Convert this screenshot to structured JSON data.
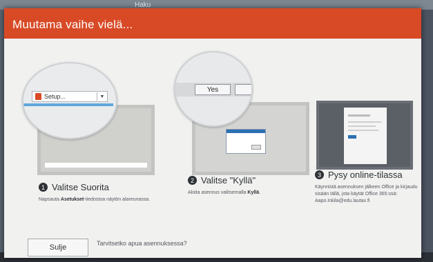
{
  "background": {
    "search_text": "Haku"
  },
  "dialog": {
    "title": "Muutama vaihe vielä...",
    "accent_color": "#d84a26",
    "steps": [
      {
        "number": "1",
        "title": "Valitse Suorita",
        "desc_prefix": "Napsauta ",
        "desc_bold": "Asetukset",
        "desc_suffix": "-tiedostoa näytön alareunassa.",
        "illustration_button": "Setup..."
      },
      {
        "number": "2",
        "title": "Valitse \"Kyllä\"",
        "desc_prefix": "Aloita asennus valitsemalla ",
        "desc_bold": "Kyllä",
        "desc_suffix": ".",
        "illustration_button": "Yes"
      },
      {
        "number": "3",
        "title": "Pysy online-tilassa",
        "desc": "Käynnistä asennuksen jälkeen Office ja kirjaudu sisään tällä, jota käytät Office 365:ssä: Aapo.Inkila@edu.lautax.fi"
      }
    ],
    "footer": {
      "close_label": "Sulje",
      "help_text": "Tarvitsetko apua asennuksessa?"
    }
  }
}
